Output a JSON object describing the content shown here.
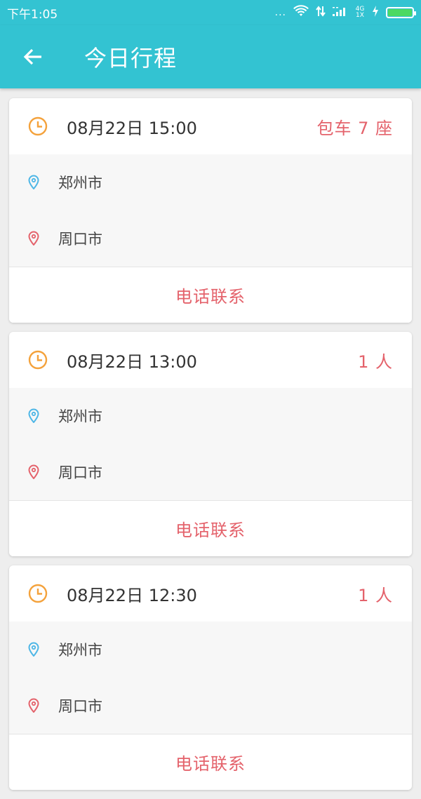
{
  "status_bar": {
    "time": "下午1:05",
    "signal_dots": "...",
    "network_label": "4G 1X",
    "icons": [
      "wifi-icon",
      "data-arrows-icon",
      "signal-icon",
      "charging-icon",
      "battery-icon"
    ],
    "battery_level": 1.0
  },
  "app_bar": {
    "title": "今日行程",
    "back_icon": "arrow-left-icon"
  },
  "colors": {
    "primary": "#33c3d2",
    "accent": "#e4626b",
    "clock": "#f4a23c",
    "origin_pin": "#4db6e6",
    "destination_pin": "#e4626b",
    "battery": "#4cd964"
  },
  "trips": [
    {
      "time": "08月22日 15:00",
      "tag": "包车 7 座",
      "origin": "郑州市",
      "destination": "周口市",
      "action": "电话联系"
    },
    {
      "time": "08月22日 13:00",
      "tag": "1 人",
      "origin": "郑州市",
      "destination": "周口市",
      "action": "电话联系"
    },
    {
      "time": "08月22日 12:30",
      "tag": "1 人",
      "origin": "郑州市",
      "destination": "周口市",
      "action": "电话联系"
    }
  ]
}
